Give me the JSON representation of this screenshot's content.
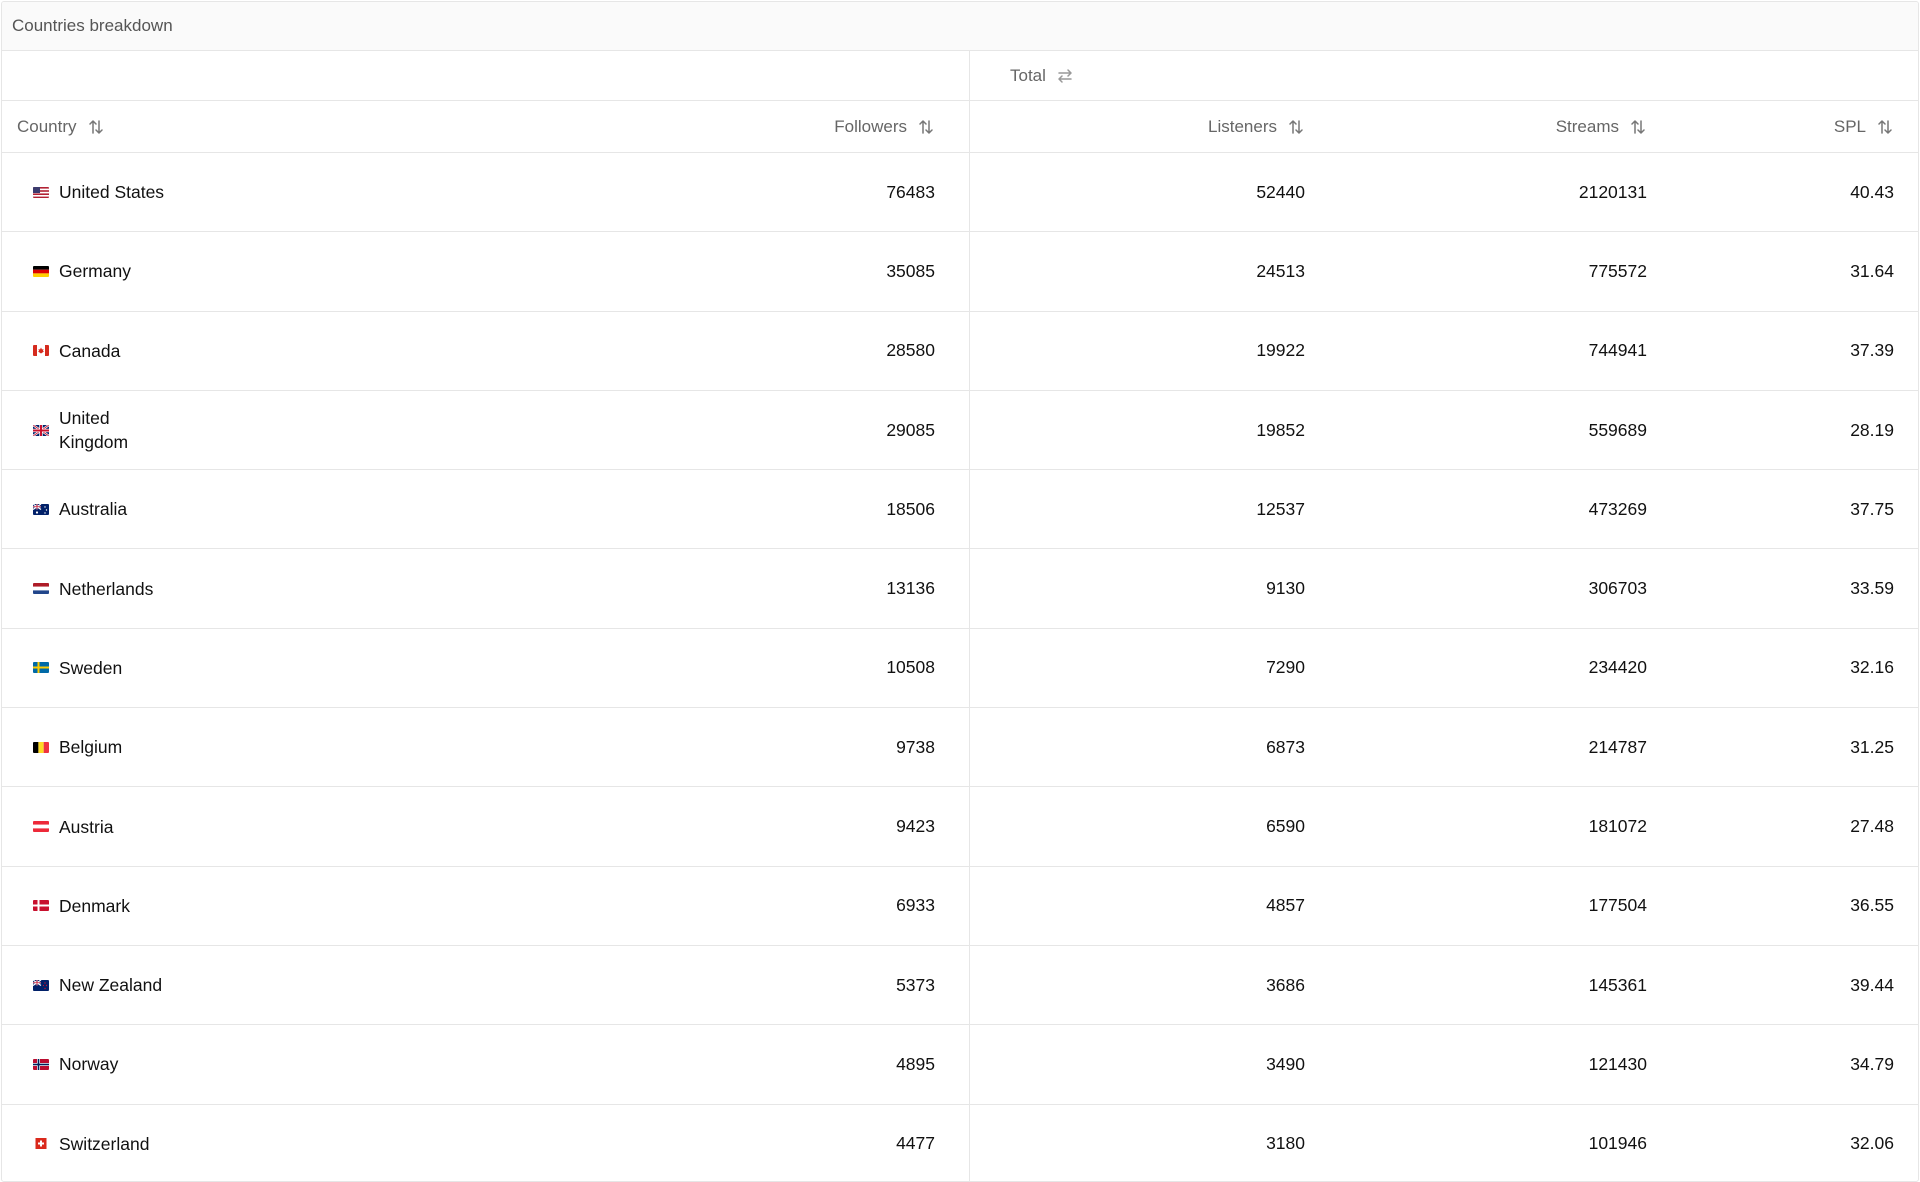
{
  "panel": {
    "title": "Countries breakdown"
  },
  "group": {
    "label": "Total",
    "toggle_icon": "swap-arrows-icon"
  },
  "columns": {
    "country": "Country",
    "followers": "Followers",
    "listeners": "Listeners",
    "streams": "Streams",
    "spl": "SPL",
    "sort_icon": "sort-arrows-icon"
  },
  "rows": [
    {
      "country": "United States",
      "flag": "us",
      "followers": "76483",
      "listeners": "52440",
      "streams": "2120131",
      "spl": "40.43"
    },
    {
      "country": "Germany",
      "flag": "de",
      "followers": "35085",
      "listeners": "24513",
      "streams": "775572",
      "spl": "31.64"
    },
    {
      "country": "Canada",
      "flag": "ca",
      "followers": "28580",
      "listeners": "19922",
      "streams": "744941",
      "spl": "37.39"
    },
    {
      "country": "United Kingdom",
      "flag": "gb",
      "followers": "29085",
      "listeners": "19852",
      "streams": "559689",
      "spl": "28.19"
    },
    {
      "country": "Australia",
      "flag": "au",
      "followers": "18506",
      "listeners": "12537",
      "streams": "473269",
      "spl": "37.75"
    },
    {
      "country": "Netherlands",
      "flag": "nl",
      "followers": "13136",
      "listeners": "9130",
      "streams": "306703",
      "spl": "33.59"
    },
    {
      "country": "Sweden",
      "flag": "se",
      "followers": "10508",
      "listeners": "7290",
      "streams": "234420",
      "spl": "32.16"
    },
    {
      "country": "Belgium",
      "flag": "be",
      "followers": "9738",
      "listeners": "6873",
      "streams": "214787",
      "spl": "31.25"
    },
    {
      "country": "Austria",
      "flag": "at",
      "followers": "9423",
      "listeners": "6590",
      "streams": "181072",
      "spl": "27.48"
    },
    {
      "country": "Denmark",
      "flag": "dk",
      "followers": "6933",
      "listeners": "4857",
      "streams": "177504",
      "spl": "36.55"
    },
    {
      "country": "New Zealand",
      "flag": "nz",
      "followers": "5373",
      "listeners": "3686",
      "streams": "145361",
      "spl": "39.44"
    },
    {
      "country": "Norway",
      "flag": "no",
      "followers": "4895",
      "listeners": "3490",
      "streams": "121430",
      "spl": "34.79"
    },
    {
      "country": "Switzerland",
      "flag": "ch",
      "followers": "4477",
      "listeners": "3180",
      "streams": "101946",
      "spl": "32.06"
    }
  ]
}
